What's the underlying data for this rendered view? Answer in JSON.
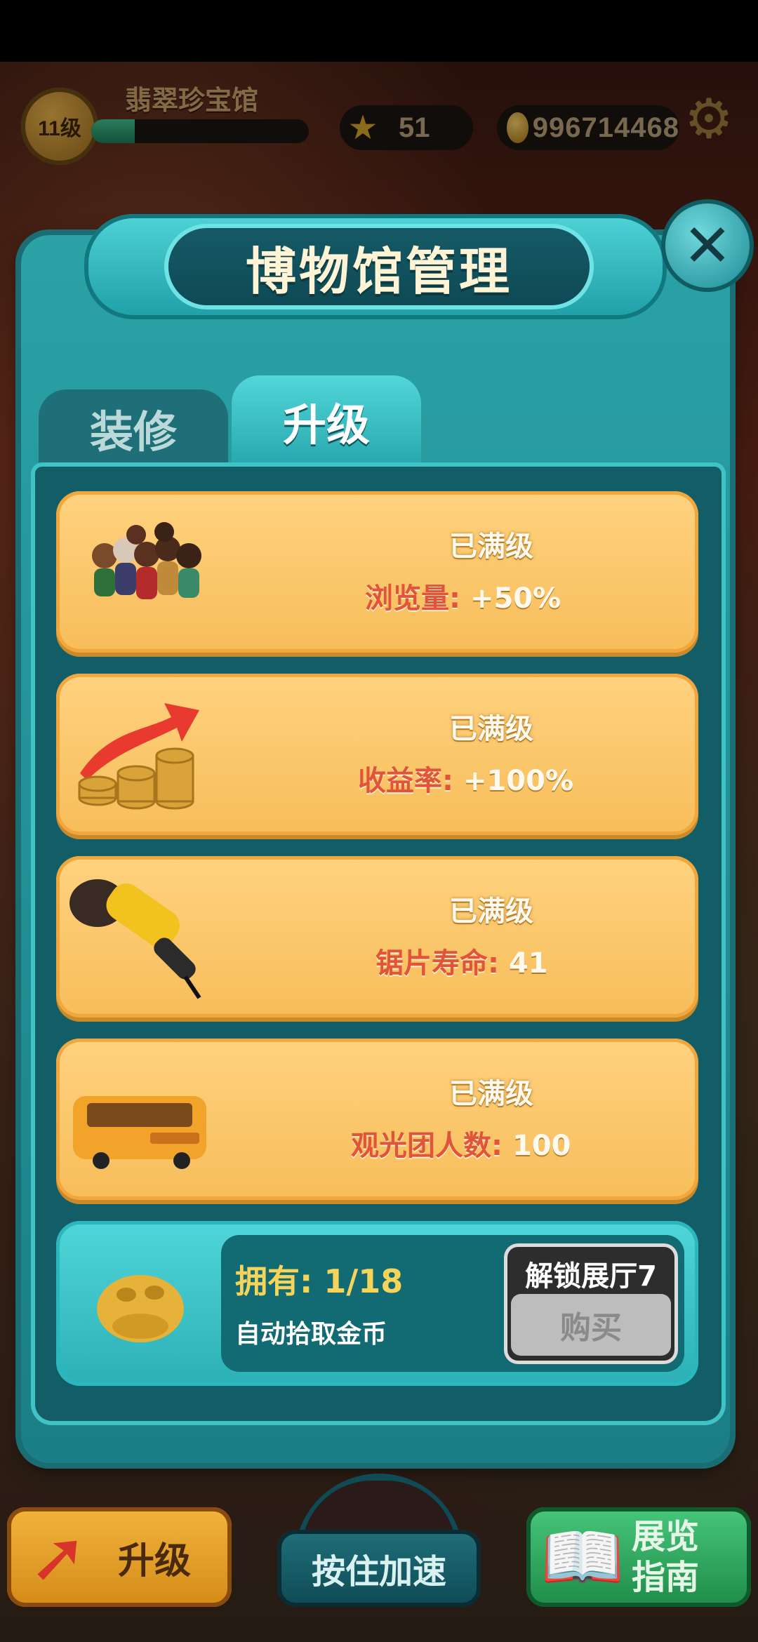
{
  "hud": {
    "level": "11级",
    "museum_name": "翡翠珍宝馆",
    "xp_progress": 0.2,
    "stars": "51",
    "coins": "996714468",
    "icons": {
      "star": "star-icon",
      "coin": "coin-icon",
      "gear": "gear-icon"
    }
  },
  "modal": {
    "title": "博物馆管理",
    "close_icon": "close-icon",
    "tabs": [
      {
        "label": "装修",
        "active": false
      },
      {
        "label": "升级",
        "active": true
      }
    ],
    "upgrades": [
      {
        "status": "已满级",
        "stat_label": "浏览量:",
        "stat_value": "+50%",
        "image": "visitors-group-image"
      },
      {
        "status": "已满级",
        "stat_label": "收益率:",
        "stat_value": "+100%",
        "image": "revenue-growth-image"
      },
      {
        "status": "已满级",
        "stat_label": "锯片寿命:",
        "stat_value": "41",
        "image": "angle-grinder-image"
      },
      {
        "status": "已满级",
        "stat_label": "观光团人数:",
        "stat_value": "100",
        "image": "tour-bus-image"
      }
    ],
    "footer": {
      "owned_label": "拥有:",
      "owned_value": "1/18",
      "description": "自动拾取金币",
      "unlock_label": "解锁展厅7",
      "buy_label": "购买",
      "image": "golden-toad-image"
    }
  },
  "bottom_bar": {
    "upgrade_label": "升级",
    "hold_speed_label": "按住加速",
    "guide_label": "展览指南"
  },
  "colors": {
    "accent_teal": "#2aa2a6",
    "card_orange": "#f7bd5a",
    "stat_red": "#e2543a",
    "gold": "#f6d45a"
  }
}
